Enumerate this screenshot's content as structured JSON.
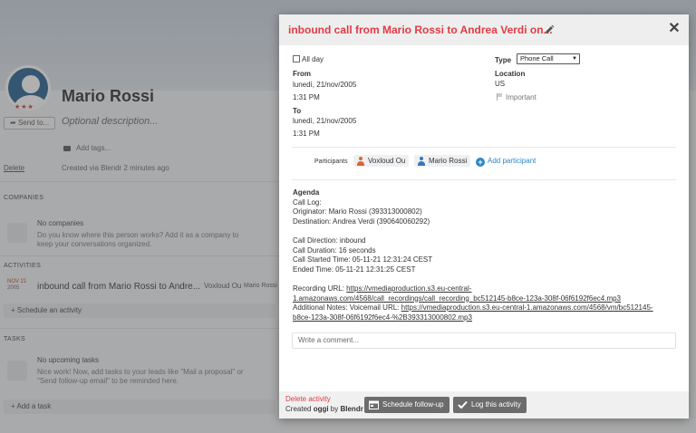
{
  "background": {
    "person_name": "Mario Rossi",
    "stars": "★★★",
    "send_label": "Send to...",
    "description_placeholder": "Optional description...",
    "add_tags": "Add tags...",
    "delete_label": "Delete",
    "created_text": "Created via Blendr 2 minutes ago",
    "companies": {
      "heading": "COMPANIES",
      "empty_title": "No companies",
      "empty_desc": "Do you know where this person works? Add it as a company to keep your conversations organized."
    },
    "activities": {
      "heading": "ACTIVITIES",
      "date_top": "NOV 21",
      "date_year": "2005",
      "title": "inbound call from Mario Rossi to Andre...",
      "owner": "Voxloud Ou",
      "person": "Mario Rossi",
      "schedule_label": "Schedule an activity"
    },
    "tasks": {
      "heading": "TASKS",
      "empty_title": "No upcoming tasks",
      "empty_desc": "Nice work! Now, add tasks to your leads like \"Mail a proposal\" or \"Send follow-up email\" to be reminded here.",
      "add_label": "Add a task"
    }
  },
  "modal": {
    "title": "inbound call from Mario Rossi to Andrea Verdi on...",
    "close_symbol": "✕",
    "all_day_label": "All day",
    "from_label": "From",
    "from_date": "lunedì, 21/nov/2005",
    "from_time": "1:31 PM",
    "to_label": "To",
    "to_date": "lunedì, 21/nov/2005",
    "to_time": "1:31 PM",
    "type_label": "Type",
    "type_value": "Phone Call",
    "location_label": "Location",
    "location_value": "US",
    "important_label": "Important",
    "participants_label": "Participants",
    "participants": [
      {
        "name": "Voxloud Ou",
        "color": "#d9662f"
      },
      {
        "name": "Mario Rossi",
        "color": "#3a78b8"
      }
    ],
    "add_participant_label": "Add participant",
    "agenda": {
      "title": "Agenda",
      "call_log": "Call Log:",
      "originator": "Originator: Mario Rossi (393313000802)",
      "destination": "Destination: Andrea Verdi (390640060292)",
      "direction": "Call Direction: inbound",
      "duration": "Call Duration: 16 seconds",
      "started": "Call Started Time: 05-11-21 12:31:24 CEST",
      "ended": "Ended Time: 05-11-21 12:31:25 CEST",
      "recording_prefix": "Recording URL: ",
      "recording_url_1": "https://vmediaproduction.s3.eu-central-",
      "recording_url_2": "1.amazonaws.com/4568/call_recordings/call_recording_bc512145-b8ce-123a-308f-06f6192f6ec4.mp3",
      "notes_prefix": "Additional Notes: Voicemail URL: ",
      "notes_url_1": "https://vmediaproduction.s3.eu-central-1.amazonaws.com/4568/vm/bc512145-",
      "notes_url_2": "b8ce-123a-308f-06f6192f6ec4-%2B393313000802.mp3"
    },
    "comment_placeholder": "Write a comment...",
    "footer": {
      "delete_label": "Delete activity",
      "created_prefix": "Created ",
      "created_when": "oggi",
      "created_by": " by ",
      "created_source": "Blendr",
      "schedule_button": "Schedule follow-up",
      "log_button": "Log this activity"
    }
  }
}
